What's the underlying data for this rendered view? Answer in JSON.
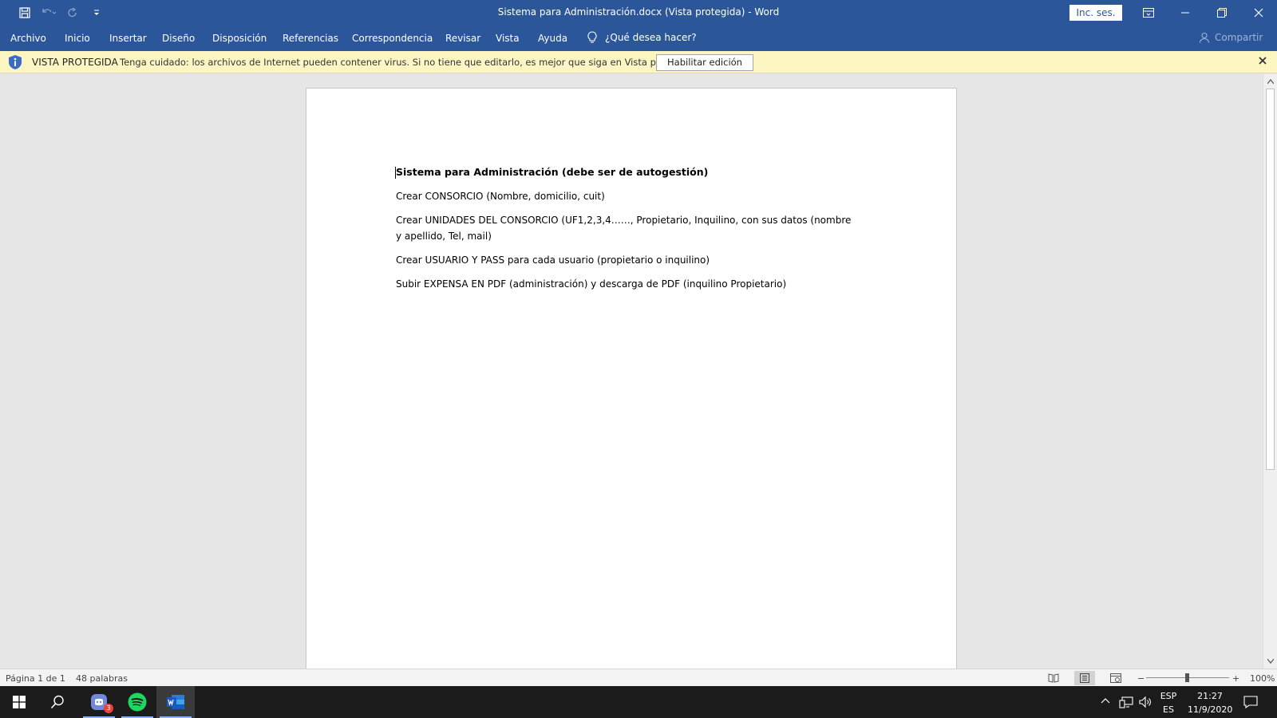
{
  "window": {
    "title": "Sistema para Administración.docx (Vista protegida)  -  Word",
    "signin_label": "Inc. ses."
  },
  "ribbon": {
    "tabs": [
      "Archivo",
      "Inicio",
      "Insertar",
      "Diseño",
      "Disposición",
      "Referencias",
      "Correspondencia",
      "Revisar",
      "Vista",
      "Ayuda"
    ],
    "tell_me": "¿Qué desea hacer?",
    "share_label": "Compartir"
  },
  "protected_view": {
    "title": "VISTA PROTEGIDA",
    "message": "Tenga cuidado: los archivos de Internet pueden contener virus. Si no tiene que editarlo, es mejor que siga en Vista protegida.",
    "button_label": "Habilitar edición"
  },
  "document": {
    "heading": "Sistema para Administración (debe ser de autogestión)",
    "paragraphs": [
      "Crear CONSORCIO (Nombre, domicilio, cuit)",
      "Crear UNIDADES DEL CONSORCIO (UF1,2,3,4……, Propietario, Inquilino, con sus datos (nombre y apellido, Tel, mail)",
      "Crear USUARIO Y PASS para cada usuario (propietario o inquilino)",
      "Subir EXPENSA EN PDF (administración) y descarga de PDF (inquilino Propietario)"
    ]
  },
  "status": {
    "page": "Página 1 de 1",
    "words": "48 palabras",
    "zoom": "100%",
    "zoom_minus": "−",
    "zoom_plus": "+"
  },
  "taskbar": {
    "discord_badge": "3",
    "lang_top": "ESP",
    "lang_bottom": "ES",
    "time": "21:27",
    "date": "11/9/2020"
  },
  "colors": {
    "word_blue": "#2b579a",
    "protected_bar": "#fdf6c3",
    "taskbar": "#1b1b1b"
  }
}
